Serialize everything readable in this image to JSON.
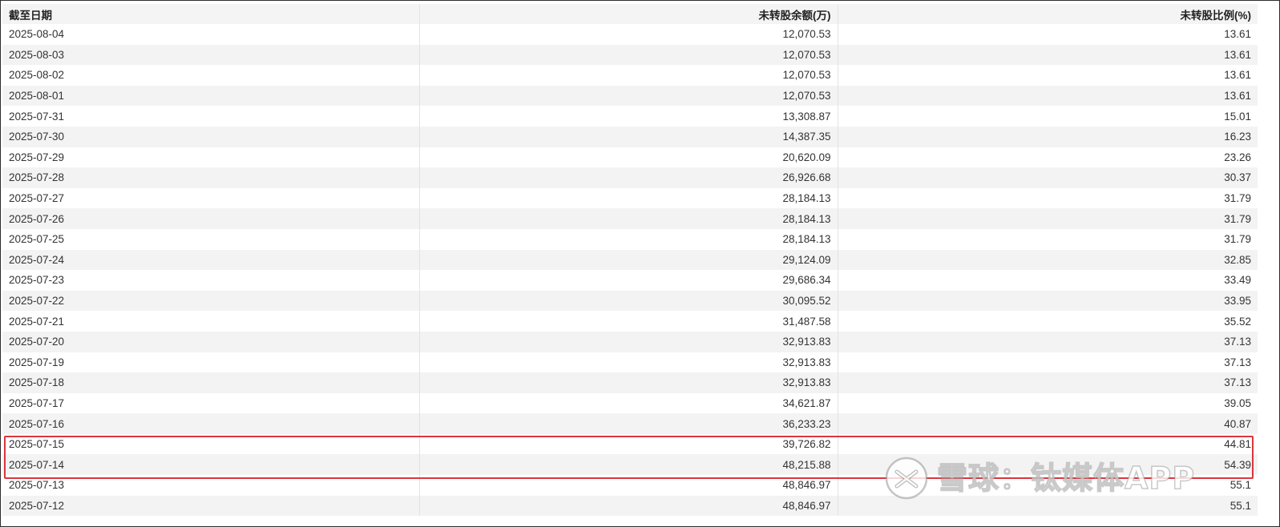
{
  "table": {
    "headers": [
      "截至日期",
      "未转股余额(万)",
      "未转股比例(%)"
    ],
    "rows": [
      [
        "2025-08-04",
        "12,070.53",
        "13.61"
      ],
      [
        "2025-08-03",
        "12,070.53",
        "13.61"
      ],
      [
        "2025-08-02",
        "12,070.53",
        "13.61"
      ],
      [
        "2025-08-01",
        "12,070.53",
        "13.61"
      ],
      [
        "2025-07-31",
        "13,308.87",
        "15.01"
      ],
      [
        "2025-07-30",
        "14,387.35",
        "16.23"
      ],
      [
        "2025-07-29",
        "20,620.09",
        "23.26"
      ],
      [
        "2025-07-28",
        "26,926.68",
        "30.37"
      ],
      [
        "2025-07-27",
        "28,184.13",
        "31.79"
      ],
      [
        "2025-07-26",
        "28,184.13",
        "31.79"
      ],
      [
        "2025-07-25",
        "28,184.13",
        "31.79"
      ],
      [
        "2025-07-24",
        "29,124.09",
        "32.85"
      ],
      [
        "2025-07-23",
        "29,686.34",
        "33.49"
      ],
      [
        "2025-07-22",
        "30,095.52",
        "33.95"
      ],
      [
        "2025-07-21",
        "31,487.58",
        "35.52"
      ],
      [
        "2025-07-20",
        "32,913.83",
        "37.13"
      ],
      [
        "2025-07-19",
        "32,913.83",
        "37.13"
      ],
      [
        "2025-07-18",
        "32,913.83",
        "37.13"
      ],
      [
        "2025-07-17",
        "34,621.87",
        "39.05"
      ],
      [
        "2025-07-16",
        "36,233.23",
        "40.87"
      ],
      [
        "2025-07-15",
        "39,726.82",
        "44.81"
      ],
      [
        "2025-07-14",
        "48,215.88",
        "54.39"
      ],
      [
        "2025-07-13",
        "48,846.97",
        "55.1"
      ],
      [
        "2025-07-12",
        "48,846.97",
        "55.1"
      ]
    ],
    "highlighted_rows": [
      "2025-07-15",
      "2025-07-14"
    ]
  },
  "colors": {
    "highlight_border": "#d9363e",
    "header_bg": "#f4f4f4",
    "stripe_bg": "#f3f3f3"
  },
  "watermark": {
    "text": "雪球：钛媒体APP",
    "icon": "snowball-logo-icon"
  }
}
